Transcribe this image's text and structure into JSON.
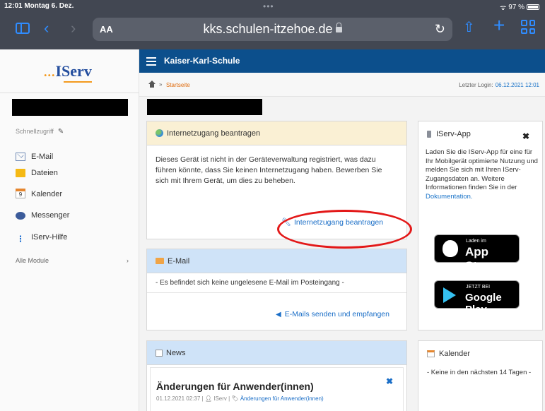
{
  "status_bar": {
    "time_date": "12:01  Montag 6. Dez.",
    "dots": "•••",
    "battery": "97 %"
  },
  "browser": {
    "aa_label": "AA",
    "url": "kks.schulen-itzehoe.de",
    "back": "‹",
    "forward": "›",
    "reload": "↻",
    "share": "⇧",
    "new_tab": "+"
  },
  "sidebar": {
    "logo_dots": "...",
    "logo_text": "IServ",
    "quick_access_label": "Schnellzugriff",
    "items": [
      {
        "label": "E-Mail",
        "icon": "mail-icon"
      },
      {
        "label": "Dateien",
        "icon": "folder-icon"
      },
      {
        "label": "Kalender",
        "icon": "calendar-icon",
        "day": "9"
      },
      {
        "label": "Messenger",
        "icon": "chat-icon"
      },
      {
        "label": "IServ-Hilfe",
        "icon": "help-icon"
      }
    ],
    "all_modules": "Alle Module",
    "all_modules_chevron": "›"
  },
  "header": {
    "school_name": "Kaiser-Karl-Schule",
    "brand_color": "#0c4f8c"
  },
  "breadcrumb": {
    "separator": "»",
    "current": "Startseite",
    "last_login_label": "Letzter Login:",
    "last_login_value": "06.12.2021 12:01"
  },
  "internet_panel": {
    "title": "Internetzugang beantragen",
    "text": "Dieses Gerät ist nicht in der Geräteverwaltung registriert, was dazu führen könnte, dass Sie keinen Internetzugang haben. Bewerben Sie sich mit Ihrem Gerät, um dies zu beheben.",
    "link": "Internetzugang beantragen"
  },
  "email_panel": {
    "title": "E-Mail",
    "message": "- Es befindet sich keine ungelesene E-Mail im Posteingang -",
    "link": "E-Mails senden und empfangen"
  },
  "news_panel": {
    "title": "News",
    "close": "✖",
    "article_title": "Änderungen für Anwender(innen)",
    "meta_date": "01.12.2021 02:37 |",
    "meta_author": "IServ |",
    "meta_tag": "Änderungen für Anwender(innen)"
  },
  "app_panel": {
    "title": "IServ-App",
    "close": "✖",
    "text": "Laden Sie die IServ-App für eine für Ihr Mobilgerät optimierte Nutzung und melden Sie sich mit Ihren IServ-Zugangsdaten an. Weitere Informationen finden Sie in der",
    "doc_link": "Dokumentation.",
    "appstore_small": "Laden im",
    "appstore_big": "App Store",
    "play_small": "JETZT BEI",
    "play_big": "Google Play"
  },
  "calendar_panel": {
    "title": "Kalender",
    "text": "- Keine in den nächsten 14 Tagen -"
  }
}
